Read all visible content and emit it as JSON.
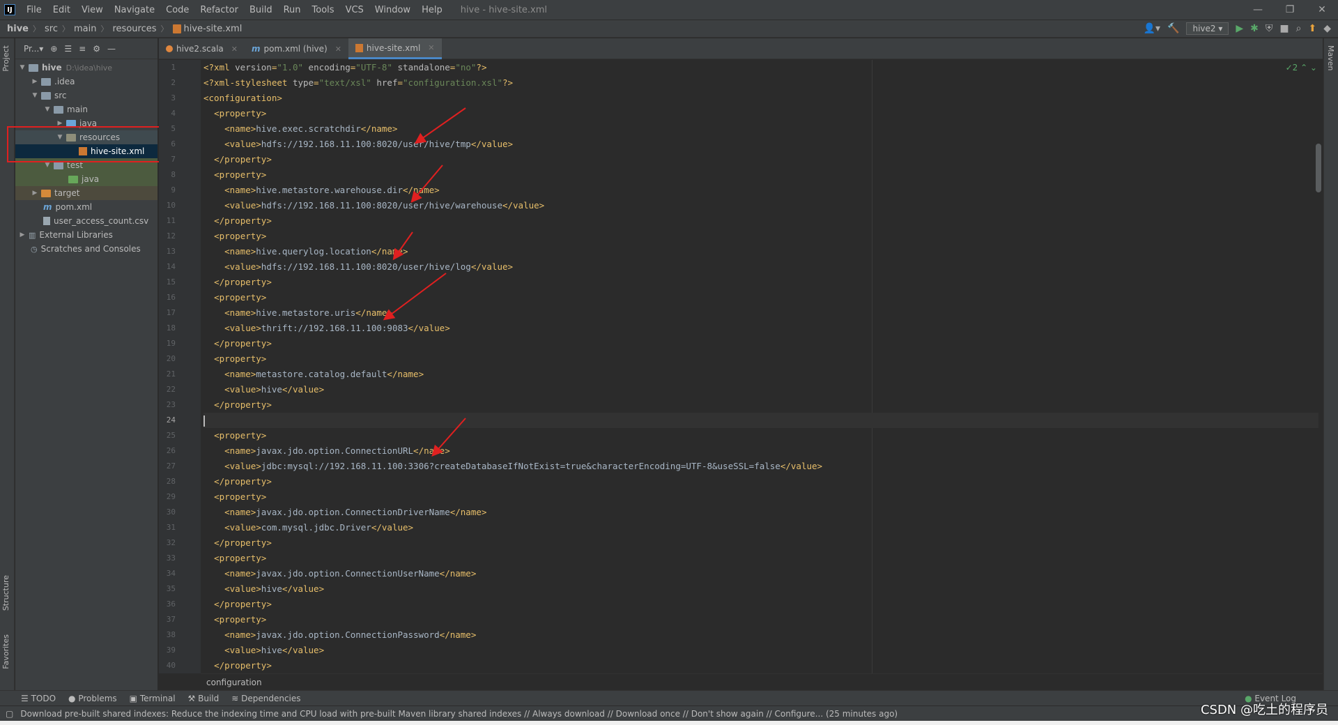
{
  "window": {
    "app_logo": "IJ",
    "title": "hive - hive-site.xml",
    "menu": [
      "File",
      "Edit",
      "View",
      "Navigate",
      "Code",
      "Refactor",
      "Build",
      "Run",
      "Tools",
      "VCS",
      "Window",
      "Help"
    ],
    "controls": [
      "—",
      "❐",
      "✕"
    ]
  },
  "navbar": {
    "crumbs": [
      "hive",
      "src",
      "main",
      "resources",
      "hive-site.xml"
    ],
    "run_config": "hive2 ▾"
  },
  "left_strip": {
    "project": "Project",
    "structure": "Structure",
    "favorites": "Favorites"
  },
  "right_strip": {
    "maven": "Maven"
  },
  "project_panel": {
    "header": "Pr...▾",
    "tree": [
      {
        "label": "hive",
        "extra": "D:\\idea\\hive"
      },
      {
        "label": ".idea"
      },
      {
        "label": "src"
      },
      {
        "label": "main"
      },
      {
        "label": "java"
      },
      {
        "label": "resources"
      },
      {
        "label": "hive-site.xml"
      },
      {
        "label": "test"
      },
      {
        "label": "java"
      },
      {
        "label": "target"
      },
      {
        "label": "pom.xml"
      },
      {
        "label": "user_access_count.csv"
      },
      {
        "label": "External Libraries"
      },
      {
        "label": "Scratches and Consoles"
      }
    ]
  },
  "tabs": [
    {
      "label": "hive2.scala"
    },
    {
      "label": "pom.xml (hive)"
    },
    {
      "label": "hive-site.xml"
    }
  ],
  "editor": {
    "inspection": "✓2 ⌃ ⌄",
    "lines": [
      "<?xml version=\"1.0\" encoding=\"UTF-8\" standalone=\"no\"?>",
      "<?xml-stylesheet type=\"text/xsl\" href=\"configuration.xsl\"?>",
      "<configuration>",
      "  <property>",
      "    <name>hive.exec.scratchdir</name>",
      "    <value>hdfs://192.168.11.100:8020/user/hive/tmp</value>",
      "  </property>",
      "  <property>",
      "    <name>hive.metastore.warehouse.dir</name>",
      "    <value>hdfs://192.168.11.100:8020/user/hive/warehouse</value>",
      "  </property>",
      "  <property>",
      "    <name>hive.querylog.location</name>",
      "    <value>hdfs://192.168.11.100:8020/user/hive/log</value>",
      "  </property>",
      "  <property>",
      "    <name>hive.metastore.uris</name>",
      "    <value>thrift://192.168.11.100:9083</value>",
      "  </property>",
      "  <property>",
      "    <name>metastore.catalog.default</name>",
      "    <value>hive</value>",
      "  </property>",
      "",
      "  <property>",
      "    <name>javax.jdo.option.ConnectionURL</name>",
      "    <value>jdbc:mysql://192.168.11.100:3306?createDatabaseIfNotExist=true&characterEncoding=UTF-8&useSSL=false</value>",
      "  </property>",
      "  <property>",
      "    <name>javax.jdo.option.ConnectionDriverName</name>",
      "    <value>com.mysql.jdbc.Driver</value>",
      "  </property>",
      "  <property>",
      "    <name>javax.jdo.option.ConnectionUserName</name>",
      "    <value>hive</value>",
      "  </property>",
      "  <property>",
      "    <name>javax.jdo.option.ConnectionPassword</name>",
      "    <value>hive</value>",
      "  </property>"
    ],
    "current_line": 24,
    "breadcrumb": "configuration"
  },
  "bottom_tools": [
    "TODO",
    "Problems",
    "Terminal",
    "Build",
    "Dependencies"
  ],
  "event_log": "Event Log",
  "status": "Download pre-built shared indexes: Reduce the indexing time and CPU load with pre-built Maven library shared indexes // Always download // Download once // Don't show again // Configure... (25 minutes ago)",
  "watermark": "CSDN @吃土的程序员",
  "colors": {
    "tag": "#e8bf6a",
    "text": "#a9b7c6",
    "string": "#6a8759",
    "annotation": "#e02020"
  }
}
